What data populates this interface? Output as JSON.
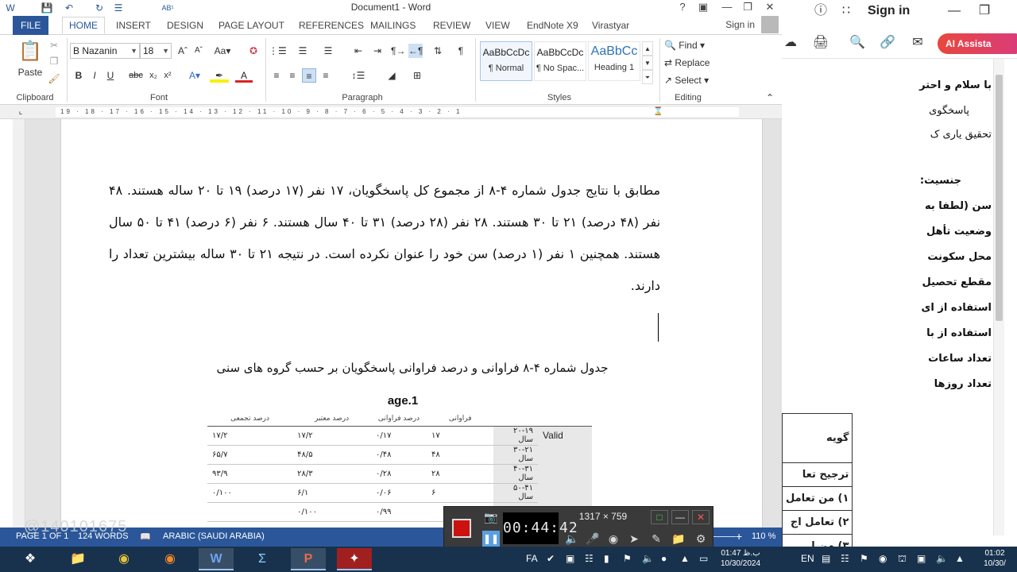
{
  "word": {
    "title": "Document1 - Word",
    "tabs": [
      "FILE",
      "HOME",
      "INSERT",
      "DESIGN",
      "PAGE LAYOUT",
      "REFERENCES",
      "MAILINGS",
      "REVIEW",
      "VIEW",
      "EndNote X9",
      "Virastyar"
    ],
    "active_tab": "HOME",
    "sign_in": "Sign in",
    "ribbon": {
      "paste": "Paste",
      "font_name": "B Nazanin",
      "font_size": "18",
      "styles": [
        {
          "preview": "AaBbCcDc",
          "name": "¶ Normal"
        },
        {
          "preview": "AaBbCcDc",
          "name": "¶ No Spac..."
        },
        {
          "preview": "AaBbCc",
          "name": "Heading 1"
        }
      ],
      "find": "Find",
      "replace": "Replace",
      "select": "Select",
      "groups": {
        "clipboard": "Clipboard",
        "font": "Font",
        "paragraph": "Paragraph",
        "styles": "Styles",
        "editing": "Editing"
      }
    },
    "ruler_numbers": "19 · 18 · 17 · 16 · 15 · 14 · 13 · 12 · 11 · 10 · 9 · 8 · 7 · 6 · 5 · 4 · 3 · 2 · 1",
    "document": {
      "paragraph": "مطابق با نتایج جدول شماره ۴-۸ از مجموع کل پاسخگویان، ۱۷ نفر (۱۷ درصد) ۱۹ تا ۲۰ ساله هستند. ۴۸ نفر (۴۸ درصد) ۲۱ تا ۳۰ هستند. ۲۸ نفر (۲۸ درصد) ۳۱ تا ۴۰ سال هستند. ۶ نفر (۶ درصد) ۴۱ تا ۵۰ سال هستند. همچنین ۱ نفر (۱ درصد) سن خود را عنوان نکرده است. در نتیجه ۲۱ تا ۳۰ ساله بیشترین تعداد را دارند.",
      "caption": "جدول شماره ۴-۸ فراوانی و درصد فراوانی پاسخگویان بر حسب گروه های سنی",
      "table_title": "age.1",
      "table_headers": [
        "فراوانی",
        "درصد فراوانی",
        "درصد معتبر",
        "درصد تجمعی"
      ],
      "valid_label": "Valid",
      "rows": [
        {
          "label": "۲۰-۱۹ سال",
          "freq": "۱۷",
          "pct": "۰/۱۷",
          "valid": "۱۷/۲",
          "cum": "۱۷/۲"
        },
        {
          "label": "۳۰-۲۱ سال",
          "freq": "۴۸",
          "pct": "۰/۴۸",
          "valid": "۴۸/۵",
          "cum": "۶۵/۷"
        },
        {
          "label": "۴۰-۳۱ سال",
          "freq": "۲۸",
          "pct": "۰/۲۸",
          "valid": "۲۸/۳",
          "cum": "۹۳/۹"
        },
        {
          "label": "۵۰-۴۱ سال",
          "freq": "۶",
          "pct": "۰/۰۶",
          "valid": "۶/۱",
          "cum": "۰/۱۰۰"
        },
        {
          "label": "",
          "freq": "",
          "pct": "۰/۹۹",
          "valid": "۰/۱۰۰",
          "cum": ""
        }
      ]
    },
    "status": {
      "page": "PAGE 1 OF 1",
      "words": "124 WORDS",
      "language": "ARABIC (SAUDI ARABIA)",
      "zoom": "110 %"
    }
  },
  "right_app": {
    "sign_in": "Sign in",
    "ai_button": "AI Assista",
    "lines": [
      "با سلام و احتر",
      "پاسخگوی",
      "تحقیق یاری ک",
      "جنسیت:",
      "سن (لطفا به",
      "وضعیت تأهل",
      "محل سکونت",
      "مقطع تحصیل",
      "استفاده از ای",
      "استفاده از با",
      "تعداد ساعات",
      "تعداد روزها"
    ],
    "table": [
      "گویه",
      "ترجیح تعا",
      "۱) من تعامل",
      "۲) تعامل اج",
      "۳) من ا"
    ]
  },
  "recorder": {
    "timer": "00:44:42",
    "resolution": "1317 × 759"
  },
  "watermark": "@140101675",
  "taskbar": {
    "lang": "FA",
    "lang2": "EN",
    "clock1_time": "01:47 ب.ظ",
    "clock1_date": "10/30/2024",
    "clock2_time": "01:02",
    "clock2_date": "10/30/"
  }
}
